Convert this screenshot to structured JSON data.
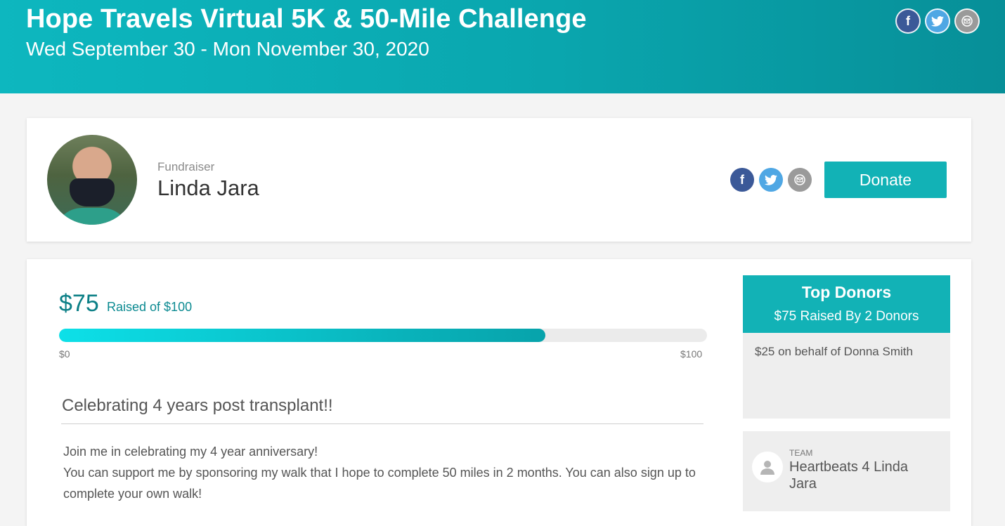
{
  "event": {
    "title": "Hope Travels Virtual 5K & 50-Mile Challenge",
    "dates": "Wed September 30 - Mon November 30, 2020"
  },
  "share_icons": [
    "facebook-icon",
    "twitter-icon",
    "email-icon"
  ],
  "fundraiser": {
    "role_label": "Fundraiser",
    "name": "Linda Jara",
    "donate_label": "Donate"
  },
  "progress": {
    "raised": "$75",
    "raised_of": "Raised of $100",
    "fraction": 0.75,
    "min_label": "$0",
    "max_label": "$100"
  },
  "story": {
    "title": "Celebrating 4 years post transplant!!",
    "lines": [
      "Join me in celebrating my 4 year anniversary!",
      "You can support me by sponsoring my walk that I hope to complete 50 miles in 2 months. You can also sign up to complete your own walk!"
    ]
  },
  "top_donors": {
    "title": "Top Donors",
    "subtitle": "$75 Raised By 2 Donors",
    "items": [
      "$25 on behalf of Donna Smith"
    ]
  },
  "team": {
    "label": "TEAM",
    "name": "Heartbeats 4 Linda Jara"
  },
  "colors": {
    "brand_teal": "#12b2b6",
    "amount_teal": "#0b7f86",
    "facebook": "#3b5998",
    "twitter": "#4fa7e4",
    "email": "#9a9a9a"
  }
}
